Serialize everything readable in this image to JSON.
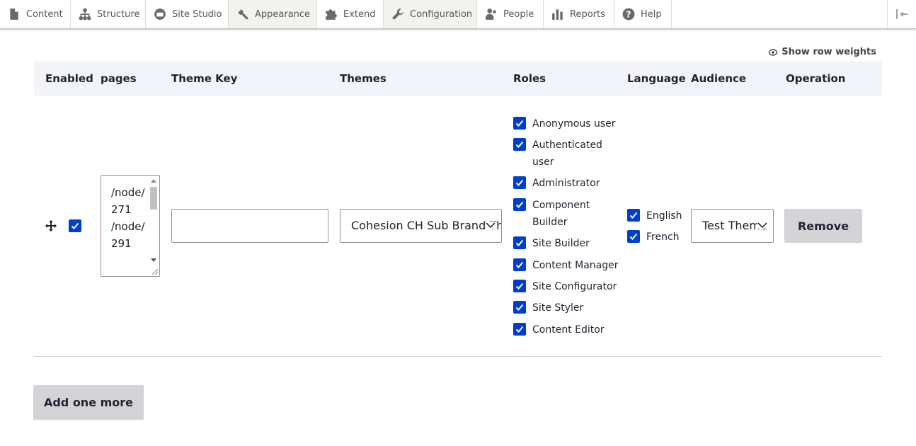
{
  "toolbar": {
    "items": [
      {
        "label": "Content",
        "icon": "file-icon"
      },
      {
        "label": "Structure",
        "icon": "sitemap-icon"
      },
      {
        "label": "Site Studio",
        "icon": "site-studio-icon"
      },
      {
        "label": "Appearance",
        "icon": "paint-icon"
      },
      {
        "label": "Extend",
        "icon": "puzzle-icon"
      },
      {
        "label": "Configuration",
        "icon": "wrench-icon"
      },
      {
        "label": "People",
        "icon": "people-icon"
      },
      {
        "label": "Reports",
        "icon": "bar-chart-icon"
      },
      {
        "label": "Help",
        "icon": "help-icon"
      }
    ],
    "toggle_icon": "collapse-toolbar-icon"
  },
  "table": {
    "show_row_weights": "Show row weights",
    "headers": {
      "enabled": "Enabled",
      "pages": "pages",
      "theme_key": "Theme Key",
      "themes": "Themes",
      "roles": "Roles",
      "language": "Language",
      "audience": "Audience",
      "operation": "Operation"
    },
    "row": {
      "enabled": true,
      "pages_value": "/node/271\n/node/291",
      "theme_key_value": "",
      "theme_selected": "Cohesion CH Sub Brand Theme",
      "roles": [
        {
          "label": "Anonymous user",
          "checked": true
        },
        {
          "label": "Authenticated user",
          "checked": true
        },
        {
          "label": "Administrator",
          "checked": true
        },
        {
          "label": "Component Builder",
          "checked": true
        },
        {
          "label": "Site Builder",
          "checked": true
        },
        {
          "label": "Content Manager",
          "checked": true
        },
        {
          "label": "Site Configurator",
          "checked": true
        },
        {
          "label": "Site Styler",
          "checked": true
        },
        {
          "label": "Content Editor",
          "checked": true
        }
      ],
      "languages": [
        {
          "label": "English",
          "checked": true
        },
        {
          "label": "French",
          "checked": true
        }
      ],
      "audience_selected": "Test Theme",
      "remove_label": "Remove"
    },
    "add_more_label": "Add one more"
  },
  "colors": {
    "accent": "#003ecc",
    "header_bg": "#f3f4f9",
    "button_bg": "#d4d4d8"
  }
}
